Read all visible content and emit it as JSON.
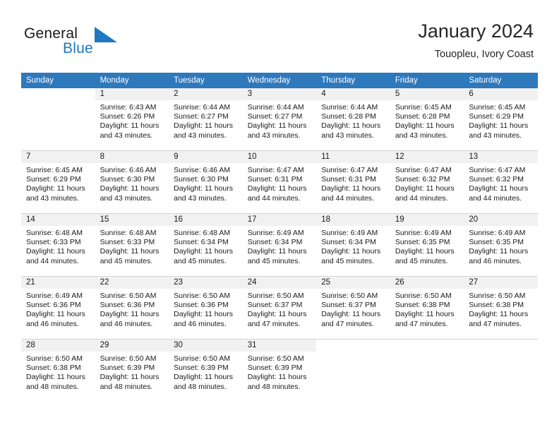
{
  "brand": {
    "word_one": "General",
    "word_two": "Blue",
    "mark": "triangle-logo",
    "accent_color": "#1f78c1"
  },
  "header": {
    "title": "January 2024",
    "subtitle": "Touopleu, Ivory Coast"
  },
  "theme": {
    "header_bar": "#2e78bc",
    "daynum_strip": "#f1f1f1",
    "grid_line": "#d4d4d4",
    "text": "#1a1a1a"
  },
  "weekday_headers": [
    "Sunday",
    "Monday",
    "Tuesday",
    "Wednesday",
    "Thursday",
    "Friday",
    "Saturday"
  ],
  "labels": {
    "sunrise_prefix": "Sunrise:",
    "sunset_prefix": "Sunset:",
    "daylight_prefix": "Daylight:"
  },
  "weeks": [
    [
      {
        "day": "",
        "sunrise": "",
        "sunset": "",
        "daylight": "",
        "empty": true,
        "leading": true
      },
      {
        "day": "1",
        "sunrise": "Sunrise: 6:43 AM",
        "sunset": "Sunset: 6:26 PM",
        "daylight": "Daylight: 11 hours and 43 minutes."
      },
      {
        "day": "2",
        "sunrise": "Sunrise: 6:44 AM",
        "sunset": "Sunset: 6:27 PM",
        "daylight": "Daylight: 11 hours and 43 minutes."
      },
      {
        "day": "3",
        "sunrise": "Sunrise: 6:44 AM",
        "sunset": "Sunset: 6:27 PM",
        "daylight": "Daylight: 11 hours and 43 minutes."
      },
      {
        "day": "4",
        "sunrise": "Sunrise: 6:44 AM",
        "sunset": "Sunset: 6:28 PM",
        "daylight": "Daylight: 11 hours and 43 minutes."
      },
      {
        "day": "5",
        "sunrise": "Sunrise: 6:45 AM",
        "sunset": "Sunset: 6:28 PM",
        "daylight": "Daylight: 11 hours and 43 minutes."
      },
      {
        "day": "6",
        "sunrise": "Sunrise: 6:45 AM",
        "sunset": "Sunset: 6:29 PM",
        "daylight": "Daylight: 11 hours and 43 minutes."
      }
    ],
    [
      {
        "day": "7",
        "sunrise": "Sunrise: 6:45 AM",
        "sunset": "Sunset: 6:29 PM",
        "daylight": "Daylight: 11 hours and 43 minutes."
      },
      {
        "day": "8",
        "sunrise": "Sunrise: 6:46 AM",
        "sunset": "Sunset: 6:30 PM",
        "daylight": "Daylight: 11 hours and 43 minutes."
      },
      {
        "day": "9",
        "sunrise": "Sunrise: 6:46 AM",
        "sunset": "Sunset: 6:30 PM",
        "daylight": "Daylight: 11 hours and 43 minutes."
      },
      {
        "day": "10",
        "sunrise": "Sunrise: 6:47 AM",
        "sunset": "Sunset: 6:31 PM",
        "daylight": "Daylight: 11 hours and 44 minutes."
      },
      {
        "day": "11",
        "sunrise": "Sunrise: 6:47 AM",
        "sunset": "Sunset: 6:31 PM",
        "daylight": "Daylight: 11 hours and 44 minutes."
      },
      {
        "day": "12",
        "sunrise": "Sunrise: 6:47 AM",
        "sunset": "Sunset: 6:32 PM",
        "daylight": "Daylight: 11 hours and 44 minutes."
      },
      {
        "day": "13",
        "sunrise": "Sunrise: 6:47 AM",
        "sunset": "Sunset: 6:32 PM",
        "daylight": "Daylight: 11 hours and 44 minutes."
      }
    ],
    [
      {
        "day": "14",
        "sunrise": "Sunrise: 6:48 AM",
        "sunset": "Sunset: 6:33 PM",
        "daylight": "Daylight: 11 hours and 44 minutes."
      },
      {
        "day": "15",
        "sunrise": "Sunrise: 6:48 AM",
        "sunset": "Sunset: 6:33 PM",
        "daylight": "Daylight: 11 hours and 45 minutes."
      },
      {
        "day": "16",
        "sunrise": "Sunrise: 6:48 AM",
        "sunset": "Sunset: 6:34 PM",
        "daylight": "Daylight: 11 hours and 45 minutes."
      },
      {
        "day": "17",
        "sunrise": "Sunrise: 6:49 AM",
        "sunset": "Sunset: 6:34 PM",
        "daylight": "Daylight: 11 hours and 45 minutes."
      },
      {
        "day": "18",
        "sunrise": "Sunrise: 6:49 AM",
        "sunset": "Sunset: 6:34 PM",
        "daylight": "Daylight: 11 hours and 45 minutes."
      },
      {
        "day": "19",
        "sunrise": "Sunrise: 6:49 AM",
        "sunset": "Sunset: 6:35 PM",
        "daylight": "Daylight: 11 hours and 45 minutes."
      },
      {
        "day": "20",
        "sunrise": "Sunrise: 6:49 AM",
        "sunset": "Sunset: 6:35 PM",
        "daylight": "Daylight: 11 hours and 46 minutes."
      }
    ],
    [
      {
        "day": "21",
        "sunrise": "Sunrise: 6:49 AM",
        "sunset": "Sunset: 6:36 PM",
        "daylight": "Daylight: 11 hours and 46 minutes."
      },
      {
        "day": "22",
        "sunrise": "Sunrise: 6:50 AM",
        "sunset": "Sunset: 6:36 PM",
        "daylight": "Daylight: 11 hours and 46 minutes."
      },
      {
        "day": "23",
        "sunrise": "Sunrise: 6:50 AM",
        "sunset": "Sunset: 6:36 PM",
        "daylight": "Daylight: 11 hours and 46 minutes."
      },
      {
        "day": "24",
        "sunrise": "Sunrise: 6:50 AM",
        "sunset": "Sunset: 6:37 PM",
        "daylight": "Daylight: 11 hours and 47 minutes."
      },
      {
        "day": "25",
        "sunrise": "Sunrise: 6:50 AM",
        "sunset": "Sunset: 6:37 PM",
        "daylight": "Daylight: 11 hours and 47 minutes."
      },
      {
        "day": "26",
        "sunrise": "Sunrise: 6:50 AM",
        "sunset": "Sunset: 6:38 PM",
        "daylight": "Daylight: 11 hours and 47 minutes."
      },
      {
        "day": "27",
        "sunrise": "Sunrise: 6:50 AM",
        "sunset": "Sunset: 6:38 PM",
        "daylight": "Daylight: 11 hours and 47 minutes."
      }
    ],
    [
      {
        "day": "28",
        "sunrise": "Sunrise: 6:50 AM",
        "sunset": "Sunset: 6:38 PM",
        "daylight": "Daylight: 11 hours and 48 minutes."
      },
      {
        "day": "29",
        "sunrise": "Sunrise: 6:50 AM",
        "sunset": "Sunset: 6:39 PM",
        "daylight": "Daylight: 11 hours and 48 minutes."
      },
      {
        "day": "30",
        "sunrise": "Sunrise: 6:50 AM",
        "sunset": "Sunset: 6:39 PM",
        "daylight": "Daylight: 11 hours and 48 minutes."
      },
      {
        "day": "31",
        "sunrise": "Sunrise: 6:50 AM",
        "sunset": "Sunset: 6:39 PM",
        "daylight": "Daylight: 11 hours and 48 minutes."
      },
      {
        "day": "",
        "sunrise": "",
        "sunset": "",
        "daylight": "",
        "empty": true
      },
      {
        "day": "",
        "sunrise": "",
        "sunset": "",
        "daylight": "",
        "empty": true
      },
      {
        "day": "",
        "sunrise": "",
        "sunset": "",
        "daylight": "",
        "empty": true
      }
    ]
  ]
}
